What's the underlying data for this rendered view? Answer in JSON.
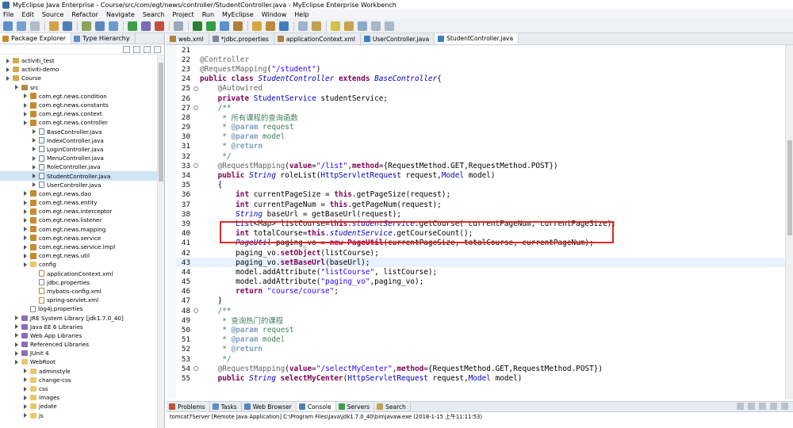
{
  "window": {
    "title": "MyEclipse Java Enterprise - Course/src/com/egt/news/controller/StudentController.java - MyEclipse Enterprise Workbench"
  },
  "menu": [
    "File",
    "Edit",
    "Source",
    "Refactor",
    "Navigate",
    "Search",
    "Project",
    "Run",
    "MyEclipse",
    "Window",
    "Help"
  ],
  "left_panel": {
    "tabs": [
      {
        "label": "Package Explorer",
        "active": true
      },
      {
        "label": "Type Hierarchy",
        "active": false
      }
    ],
    "tree": [
      {
        "label": "activiti_test",
        "depth": 1,
        "icon": "project",
        "twisty": true
      },
      {
        "label": "activiti-demo",
        "depth": 1,
        "icon": "project",
        "twisty": true
      },
      {
        "label": "Course",
        "depth": 1,
        "icon": "project",
        "twisty": true
      },
      {
        "label": "src",
        "depth": 2,
        "icon": "src",
        "twisty": true
      },
      {
        "label": "com.egt.news.condition",
        "depth": 3,
        "icon": "package",
        "twisty": true
      },
      {
        "label": "com.egt.news.constants",
        "depth": 3,
        "icon": "package",
        "twisty": true
      },
      {
        "label": "com.egt.news.context",
        "depth": 3,
        "icon": "package",
        "twisty": true
      },
      {
        "label": "com.egt.news.controller",
        "depth": 3,
        "icon": "package",
        "twisty": true
      },
      {
        "label": "BaseController.java",
        "depth": 4,
        "icon": "java",
        "twisty": true
      },
      {
        "label": "IndexController.java",
        "depth": 4,
        "icon": "java",
        "twisty": true
      },
      {
        "label": "LoginController.java",
        "depth": 4,
        "icon": "java",
        "twisty": true
      },
      {
        "label": "MenuController.java",
        "depth": 4,
        "icon": "java",
        "twisty": true
      },
      {
        "label": "RoleController.java",
        "depth": 4,
        "icon": "java",
        "twisty": true
      },
      {
        "label": "StudentController.java",
        "depth": 4,
        "icon": "java",
        "twisty": true,
        "selected": true
      },
      {
        "label": "UserController.java",
        "depth": 4,
        "icon": "java",
        "twisty": true
      },
      {
        "label": "com.egt.news.dao",
        "depth": 3,
        "icon": "package",
        "twisty": true
      },
      {
        "label": "com.egt.news.entity",
        "depth": 3,
        "icon": "package",
        "twisty": true
      },
      {
        "label": "com.egt.news.interceptor",
        "depth": 3,
        "icon": "package",
        "twisty": true
      },
      {
        "label": "com.egt.news.listener",
        "depth": 3,
        "icon": "package",
        "twisty": true
      },
      {
        "label": "com.egt.news.mapping",
        "depth": 3,
        "icon": "package",
        "twisty": true
      },
      {
        "label": "com.egt.news.service",
        "depth": 3,
        "icon": "package",
        "twisty": true
      },
      {
        "label": "com.egt.news.service.impl",
        "depth": 3,
        "icon": "package",
        "twisty": true
      },
      {
        "label": "com.egt.news.util",
        "depth": 3,
        "icon": "package",
        "twisty": true
      },
      {
        "label": "config",
        "depth": 3,
        "icon": "folder",
        "twisty": true
      },
      {
        "label": "applicationContext.xml",
        "depth": 4,
        "icon": "xml",
        "twisty": false
      },
      {
        "label": "jdbc.properties",
        "depth": 4,
        "icon": "props",
        "twisty": false
      },
      {
        "label": "mybatis-config.xml",
        "depth": 4,
        "icon": "xml",
        "twisty": false
      },
      {
        "label": "spring-servlet.xml",
        "depth": 4,
        "icon": "xml",
        "twisty": false
      },
      {
        "label": "log4j.properties",
        "depth": 3,
        "icon": "props",
        "twisty": false
      },
      {
        "label": "JRE System Library [jdk1.7.0_40]",
        "depth": 2,
        "icon": "lib",
        "twisty": true
      },
      {
        "label": "Java EE 6 Libraries",
        "depth": 2,
        "icon": "lib",
        "twisty": true
      },
      {
        "label": "Web App Libraries",
        "depth": 2,
        "icon": "lib",
        "twisty": true
      },
      {
        "label": "Referenced Libraries",
        "depth": 2,
        "icon": "lib",
        "twisty": true
      },
      {
        "label": "JUnit 4",
        "depth": 2,
        "icon": "lib",
        "twisty": true
      },
      {
        "label": "WebRoot",
        "depth": 2,
        "icon": "folder",
        "twisty": true
      },
      {
        "label": "adminstyle",
        "depth": 3,
        "icon": "folder",
        "twisty": true
      },
      {
        "label": "change-css",
        "depth": 3,
        "icon": "folder",
        "twisty": true
      },
      {
        "label": "css",
        "depth": 3,
        "icon": "folder",
        "twisty": true
      },
      {
        "label": "images",
        "depth": 3,
        "icon": "folder",
        "twisty": true
      },
      {
        "label": "jedate",
        "depth": 3,
        "icon": "folder",
        "twisty": true
      },
      {
        "label": "js",
        "depth": 3,
        "icon": "folder",
        "twisty": true
      }
    ]
  },
  "editor": {
    "tabs": [
      {
        "label": "web.xml",
        "active": false
      },
      {
        "label": "*jdbc.properties",
        "active": false
      },
      {
        "label": "applicationContext.xml",
        "active": false
      },
      {
        "label": "UserController.java",
        "active": false
      },
      {
        "label": "StudentController.java",
        "active": true
      }
    ],
    "lines": [
      {
        "n": "21",
        "tokens": [
          [
            "pl",
            ""
          ]
        ]
      },
      {
        "n": "22",
        "tokens": [
          [
            "ann",
            "@Controller"
          ]
        ]
      },
      {
        "n": "23",
        "tokens": [
          [
            "ann",
            "@RequestMapping"
          ],
          [
            "pl",
            "("
          ],
          [
            "str",
            "\"/student\""
          ],
          [
            "pl",
            ")"
          ]
        ]
      },
      {
        "n": "24",
        "tokens": [
          [
            "kw",
            "public class "
          ],
          [
            "itype",
            "StudentController "
          ],
          [
            "kw",
            "extends "
          ],
          [
            "itype",
            "BaseController"
          ],
          [
            "pl",
            "{"
          ]
        ]
      },
      {
        "n": "25",
        "fold": true,
        "tokens": [
          [
            "pl",
            "    "
          ],
          [
            "ann",
            "@Autowired"
          ]
        ]
      },
      {
        "n": "26",
        "tokens": [
          [
            "pl",
            "    "
          ],
          [
            "kw",
            "private "
          ],
          [
            "type",
            "StudentService "
          ],
          [
            "pl",
            "studentService;"
          ]
        ]
      },
      {
        "n": "27",
        "fold": true,
        "tokens": [
          [
            "pl",
            "    "
          ],
          [
            "cm",
            "/**"
          ]
        ]
      },
      {
        "n": "28",
        "tokens": [
          [
            "pl",
            "     "
          ],
          [
            "cm",
            "* 所有课程的查询函数"
          ]
        ]
      },
      {
        "n": "29",
        "tokens": [
          [
            "pl",
            "     "
          ],
          [
            "cm",
            "* "
          ],
          [
            "cmtag",
            "@param "
          ],
          [
            "cm",
            "request"
          ]
        ]
      },
      {
        "n": "30",
        "tokens": [
          [
            "pl",
            "     "
          ],
          [
            "cm",
            "* "
          ],
          [
            "cmtag",
            "@param "
          ],
          [
            "cm",
            "model"
          ]
        ]
      },
      {
        "n": "31",
        "tokens": [
          [
            "pl",
            "     "
          ],
          [
            "cm",
            "* "
          ],
          [
            "cmtag",
            "@return"
          ]
        ]
      },
      {
        "n": "32",
        "tokens": [
          [
            "pl",
            "     "
          ],
          [
            "cm",
            "*/"
          ]
        ]
      },
      {
        "n": "33",
        "fold": true,
        "tokens": [
          [
            "pl",
            "    "
          ],
          [
            "ann",
            "@RequestMapping"
          ],
          [
            "pl",
            "("
          ],
          [
            "kw",
            "value"
          ],
          [
            "pl",
            "="
          ],
          [
            "str",
            "\"/list\""
          ],
          [
            "pl",
            ","
          ],
          [
            "kw",
            "method"
          ],
          [
            "pl",
            "={RequestMethod.GET,RequestMethod.POST})"
          ]
        ]
      },
      {
        "n": "34",
        "tokens": [
          [
            "pl",
            "    "
          ],
          [
            "kw",
            "public "
          ],
          [
            "itype",
            "String "
          ],
          [
            "pl",
            "roleList("
          ],
          [
            "type",
            "HttpServletRequest "
          ],
          [
            "pl",
            "request,"
          ],
          [
            "type",
            "Model "
          ],
          [
            "pl",
            "model)"
          ]
        ]
      },
      {
        "n": "35",
        "tokens": [
          [
            "pl",
            "    {"
          ]
        ]
      },
      {
        "n": "36",
        "tokens": [
          [
            "pl",
            "        "
          ],
          [
            "kw",
            "int "
          ],
          [
            "pl",
            "currentPageSize = "
          ],
          [
            "kw",
            "this"
          ],
          [
            "pl",
            ".getPageSize(request);"
          ]
        ]
      },
      {
        "n": "37",
        "tokens": [
          [
            "pl",
            "        "
          ],
          [
            "kw",
            "int "
          ],
          [
            "pl",
            "currentPageNum = "
          ],
          [
            "kw",
            "this"
          ],
          [
            "pl",
            ".getPageNum(request);"
          ]
        ]
      },
      {
        "n": "38",
        "tokens": [
          [
            "pl",
            "        "
          ],
          [
            "itype",
            "String "
          ],
          [
            "pl",
            "baseUrl = getBaseUrl(request);"
          ]
        ]
      },
      {
        "n": "39",
        "tokens": [
          [
            "pl",
            "        "
          ],
          [
            "type",
            "List"
          ],
          [
            "pl",
            "<Map> listCourse="
          ],
          [
            "kw",
            "this"
          ],
          [
            "pl",
            "."
          ],
          [
            "fld",
            "studentService"
          ],
          [
            "pl",
            ".getCourse( currentPageNum, currentPageSize);"
          ]
        ]
      },
      {
        "n": "40",
        "tokens": [
          [
            "pl",
            "        "
          ],
          [
            "kw",
            "int "
          ],
          [
            "pl",
            "totalCourse="
          ],
          [
            "kw",
            "this"
          ],
          [
            "pl",
            "."
          ],
          [
            "fld",
            "studentService"
          ],
          [
            "pl",
            ".getCourseCount();"
          ]
        ]
      },
      {
        "n": "41",
        "tokens": [
          [
            "pl",
            "        "
          ],
          [
            "itype",
            "PageUtil "
          ],
          [
            "pl",
            "paging_vo = "
          ],
          [
            "kw",
            "new "
          ],
          [
            "kw",
            "PageUtil"
          ],
          [
            "pl",
            "(currentPageSize, totalCourse, currentPageNum);"
          ]
        ]
      },
      {
        "n": "42",
        "tokens": [
          [
            "pl",
            "        paging_vo."
          ],
          [
            "kw",
            "setObject"
          ],
          [
            "pl",
            "(listCourse);"
          ]
        ]
      },
      {
        "n": "43",
        "hl": true,
        "tokens": [
          [
            "pl",
            "        paging_vo."
          ],
          [
            "kw",
            "setBaseUrl"
          ],
          [
            "pl",
            "(baseUrl);"
          ]
        ]
      },
      {
        "n": "44",
        "tokens": [
          [
            "pl",
            "        model.addAttribute("
          ],
          [
            "str",
            "\"listCourse\""
          ],
          [
            "pl",
            ", listCourse);"
          ]
        ]
      },
      {
        "n": "45",
        "tokens": [
          [
            "pl",
            "        model.addAttribute("
          ],
          [
            "str",
            "\"paging_vo\""
          ],
          [
            "pl",
            ",paging_vo);"
          ]
        ]
      },
      {
        "n": "46",
        "tokens": [
          [
            "pl",
            "        "
          ],
          [
            "kw",
            "return "
          ],
          [
            "str",
            "\"course/course\""
          ],
          [
            "pl",
            ";"
          ]
        ]
      },
      {
        "n": "47",
        "tokens": [
          [
            "pl",
            "    }"
          ]
        ]
      },
      {
        "n": "48",
        "fold": true,
        "tokens": [
          [
            "pl",
            "    "
          ],
          [
            "cm",
            "/**"
          ]
        ]
      },
      {
        "n": "49",
        "tokens": [
          [
            "pl",
            "     "
          ],
          [
            "cm",
            "* 查询热门的课程"
          ]
        ]
      },
      {
        "n": "50",
        "tokens": [
          [
            "pl",
            "     "
          ],
          [
            "cm",
            "* "
          ],
          [
            "cmtag",
            "@param "
          ],
          [
            "cm",
            "request"
          ]
        ]
      },
      {
        "n": "51",
        "tokens": [
          [
            "pl",
            "     "
          ],
          [
            "cm",
            "* "
          ],
          [
            "cmtag",
            "@param "
          ],
          [
            "cm",
            "model"
          ]
        ]
      },
      {
        "n": "52",
        "tokens": [
          [
            "pl",
            "     "
          ],
          [
            "cm",
            "* "
          ],
          [
            "cmtag",
            "@return"
          ]
        ]
      },
      {
        "n": "53",
        "tokens": [
          [
            "pl",
            "     "
          ],
          [
            "cm",
            "*/"
          ]
        ]
      },
      {
        "n": "54",
        "fold": true,
        "tokens": [
          [
            "pl",
            "    "
          ],
          [
            "ann",
            "@RequestMapping"
          ],
          [
            "pl",
            "("
          ],
          [
            "kw",
            "value"
          ],
          [
            "pl",
            "="
          ],
          [
            "str",
            "\"/selectMyCenter\""
          ],
          [
            "pl",
            ","
          ],
          [
            "kw",
            "method"
          ],
          [
            "pl",
            "={RequestMethod.GET,RequestMethod.POST})"
          ]
        ]
      },
      {
        "n": "55",
        "tokens": [
          [
            "pl",
            "    "
          ],
          [
            "kw",
            "public "
          ],
          [
            "itype",
            "String "
          ],
          [
            "kw",
            "selectMyCenter"
          ],
          [
            "pl",
            "("
          ],
          [
            "type",
            "HttpServletRequest "
          ],
          [
            "pl",
            "request,"
          ],
          [
            "type",
            "Model "
          ],
          [
            "pl",
            "model)"
          ]
        ]
      }
    ]
  },
  "bottom_panel": {
    "tabs": [
      {
        "label": "Problems",
        "active": false
      },
      {
        "label": "Tasks",
        "active": false
      },
      {
        "label": "Web Browser",
        "active": false
      },
      {
        "label": "Console",
        "active": true
      },
      {
        "label": "Servers",
        "active": false
      },
      {
        "label": "Search",
        "active": false
      }
    ],
    "console_text": "tomcat7Server [Remote Java Application] C:\\Program Files\\Java\\jdk1.7.0_40\\bin\\javaw.exe (2018-1-15 上午11:11:53)"
  },
  "colors": {
    "keyword": "#7f0055",
    "string": "#2a00ff",
    "comment": "#3f7f5f",
    "annotation": "#646464",
    "highlight_box": "#e3282a",
    "selection": "#cfe3f7"
  }
}
